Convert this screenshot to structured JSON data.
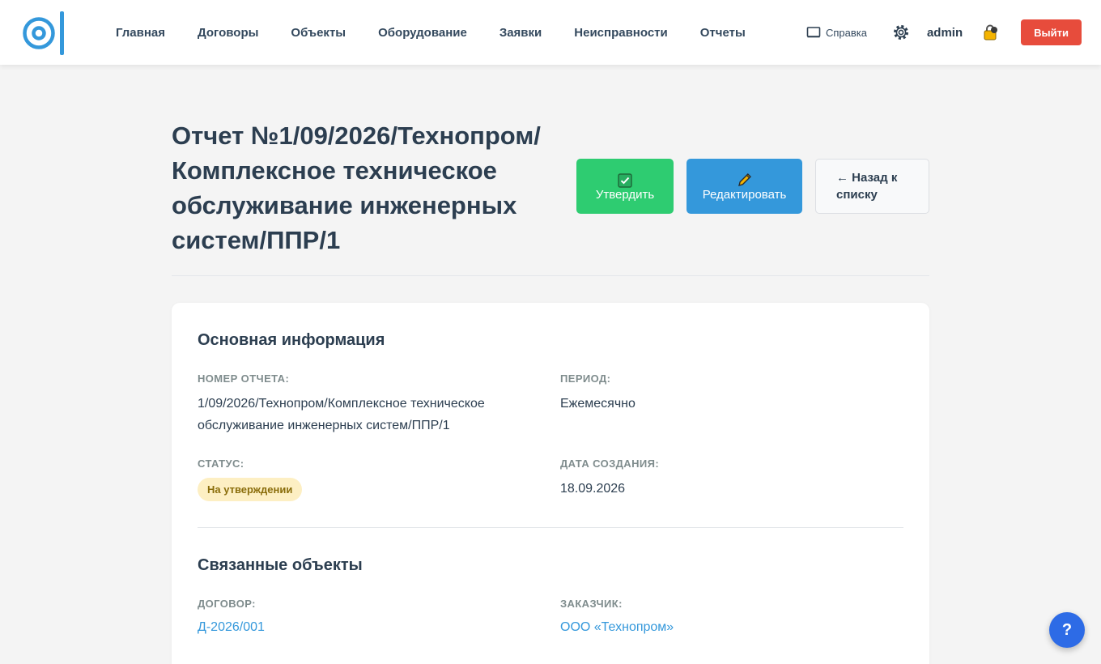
{
  "nav": {
    "items": [
      "Главная",
      "Договоры",
      "Объекты",
      "Оборудование",
      "Заявки",
      "Неисправности",
      "Отчеты"
    ],
    "help": "Справка",
    "user": "admin",
    "logout": "Выйти"
  },
  "page": {
    "title": "Отчет №1/09/2026/Технопром/Комплексное техническое обслуживание инженерных систем/ППР/1",
    "approve_label": "Утвердить",
    "edit_label": "Редактировать",
    "back_label": "← Назад к списку"
  },
  "main_info": {
    "title": "Основная информация",
    "number_label": "НОМЕР ОТЧЕТА:",
    "number_value": "1/09/2026/Технопром/Комплексное техническое обслуживание инженерных систем/ППР/1",
    "period_label": "ПЕРИОД:",
    "period_value": "Ежемесячно",
    "status_label": "СТАТУС:",
    "status_value": "На утверждении",
    "created_label": "ДАТА СОЗДАНИЯ:",
    "created_value": "18.09.2026"
  },
  "related": {
    "title": "Связанные объекты",
    "contract_label": "ДОГОВОР:",
    "contract_value": "Д-2026/001",
    "customer_label": "ЗАКАЗЧИК:",
    "customer_value": "ООО «Технопром»"
  },
  "help_fab": "?",
  "colors": {
    "primary": "#3498db",
    "success": "#2ecc71",
    "danger": "#e74c3c",
    "status_bg": "#fdefc3",
    "fab": "#2d6be6"
  },
  "icons": {
    "logo": "logo-icon",
    "help": "book-icon",
    "settings": "gear-icon",
    "lock": "lock-icon",
    "approve": "checkbox-icon",
    "edit": "pencil-icon"
  }
}
